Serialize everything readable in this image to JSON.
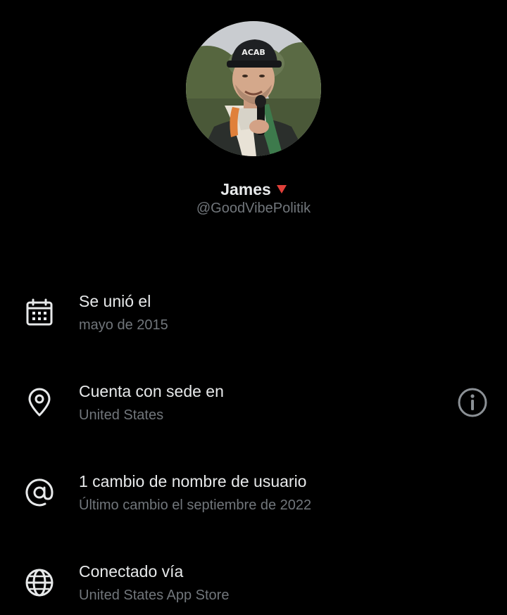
{
  "profile": {
    "name": "James",
    "handle": "@GoodVibePolitik",
    "flag_color": "#e0403a",
    "avatar_cap_text": "ACAB"
  },
  "about": {
    "items": [
      {
        "icon": "calendar-icon",
        "title": "Se unió el",
        "subtitle": "mayo de 2015"
      },
      {
        "icon": "location-pin-icon",
        "title": "Cuenta con sede en",
        "subtitle": "United States",
        "action_icon": "info-icon"
      },
      {
        "icon": "at-sign-icon",
        "title": "1 cambio de nombre de usuario",
        "subtitle": "Último cambio el septiembre de 2022"
      },
      {
        "icon": "globe-icon",
        "title": "Conectado vía",
        "subtitle": "United States App Store"
      }
    ]
  },
  "colors": {
    "background": "#000000",
    "primary_text": "#e7e9ea",
    "secondary_text": "#71767b",
    "icon": "#e7e9ea"
  }
}
